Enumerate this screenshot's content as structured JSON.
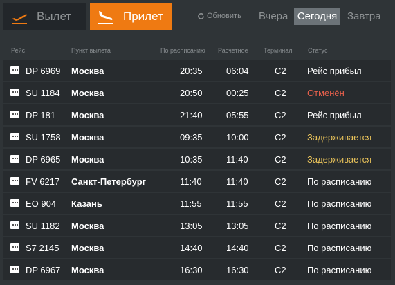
{
  "tabs": {
    "departure": {
      "label": "Вылет",
      "icon": "plane-takeoff-icon"
    },
    "arrival": {
      "label": "Прилет",
      "icon": "plane-landing-icon",
      "active": true
    }
  },
  "refresh": {
    "label": "Обновить",
    "icon": "refresh-icon"
  },
  "days": {
    "yesterday": "Вчера",
    "today": "Сегодня",
    "tomorrow": "Завтра",
    "selected": "today"
  },
  "columns": {
    "flight": "Рейс",
    "origin": "Пункт вылета",
    "scheduled": "По расписанию",
    "estimated": "Расчетное",
    "terminal": "Терминал",
    "status": "Статус"
  },
  "colors": {
    "accent": "#ef7a12",
    "status_arrived": "#ffffff",
    "status_cancelled": "#e8604c",
    "status_delayed": "#e8c25a",
    "status_on_time": "#ffffff"
  },
  "flights": [
    {
      "flight": "DP 6969",
      "origin": "Москва",
      "scheduled": "20:35",
      "estimated": "06:04",
      "terminal": "C2",
      "status": "Рейс прибыл",
      "status_type": "arrived",
      "airline_logo": "pobeda-logo-icon"
    },
    {
      "flight": "SU 1184",
      "origin": "Москва",
      "scheduled": "20:50",
      "estimated": "00:25",
      "terminal": "C2",
      "status": "Отменён",
      "status_type": "cancelled",
      "airline_logo": "aeroflot-logo-icon"
    },
    {
      "flight": "DP 181",
      "origin": "Москва",
      "scheduled": "21:40",
      "estimated": "05:55",
      "terminal": "C2",
      "status": "Рейс прибыл",
      "status_type": "arrived",
      "airline_logo": "pobeda-logo-icon"
    },
    {
      "flight": "SU 1758",
      "origin": "Москва",
      "scheduled": "09:35",
      "estimated": "10:00",
      "terminal": "C2",
      "status": "Задерживается",
      "status_type": "delayed",
      "airline_logo": "aeroflot-logo-icon"
    },
    {
      "flight": "DP 6965",
      "origin": "Москва",
      "scheduled": "10:35",
      "estimated": "11:40",
      "terminal": "C2",
      "status": "Задерживается",
      "status_type": "delayed",
      "airline_logo": "pobeda-logo-icon"
    },
    {
      "flight": "FV 6217",
      "origin": "Санкт-Петербург",
      "scheduled": "11:40",
      "estimated": "11:40",
      "terminal": "C2",
      "status": "По расписанию",
      "status_type": "on_time",
      "airline_logo": "rossiya-logo-icon"
    },
    {
      "flight": "EO 904",
      "origin": "Казань",
      "scheduled": "11:55",
      "estimated": "11:55",
      "terminal": "C2",
      "status": "По расписанию",
      "status_type": "on_time",
      "airline_logo": "ikar-logo-icon"
    },
    {
      "flight": "SU 1182",
      "origin": "Москва",
      "scheduled": "13:05",
      "estimated": "13:05",
      "terminal": "C2",
      "status": "По расписанию",
      "status_type": "on_time",
      "airline_logo": "aeroflot-logo-icon"
    },
    {
      "flight": "S7 2145",
      "origin": "Москва",
      "scheduled": "14:40",
      "estimated": "14:40",
      "terminal": "C2",
      "status": "По расписанию",
      "status_type": "on_time",
      "airline_logo": "s7-logo-icon"
    },
    {
      "flight": "DP 6967",
      "origin": "Москва",
      "scheduled": "16:30",
      "estimated": "16:30",
      "terminal": "C2",
      "status": "По расписанию",
      "status_type": "on_time",
      "airline_logo": "pobeda-logo-icon"
    }
  ]
}
